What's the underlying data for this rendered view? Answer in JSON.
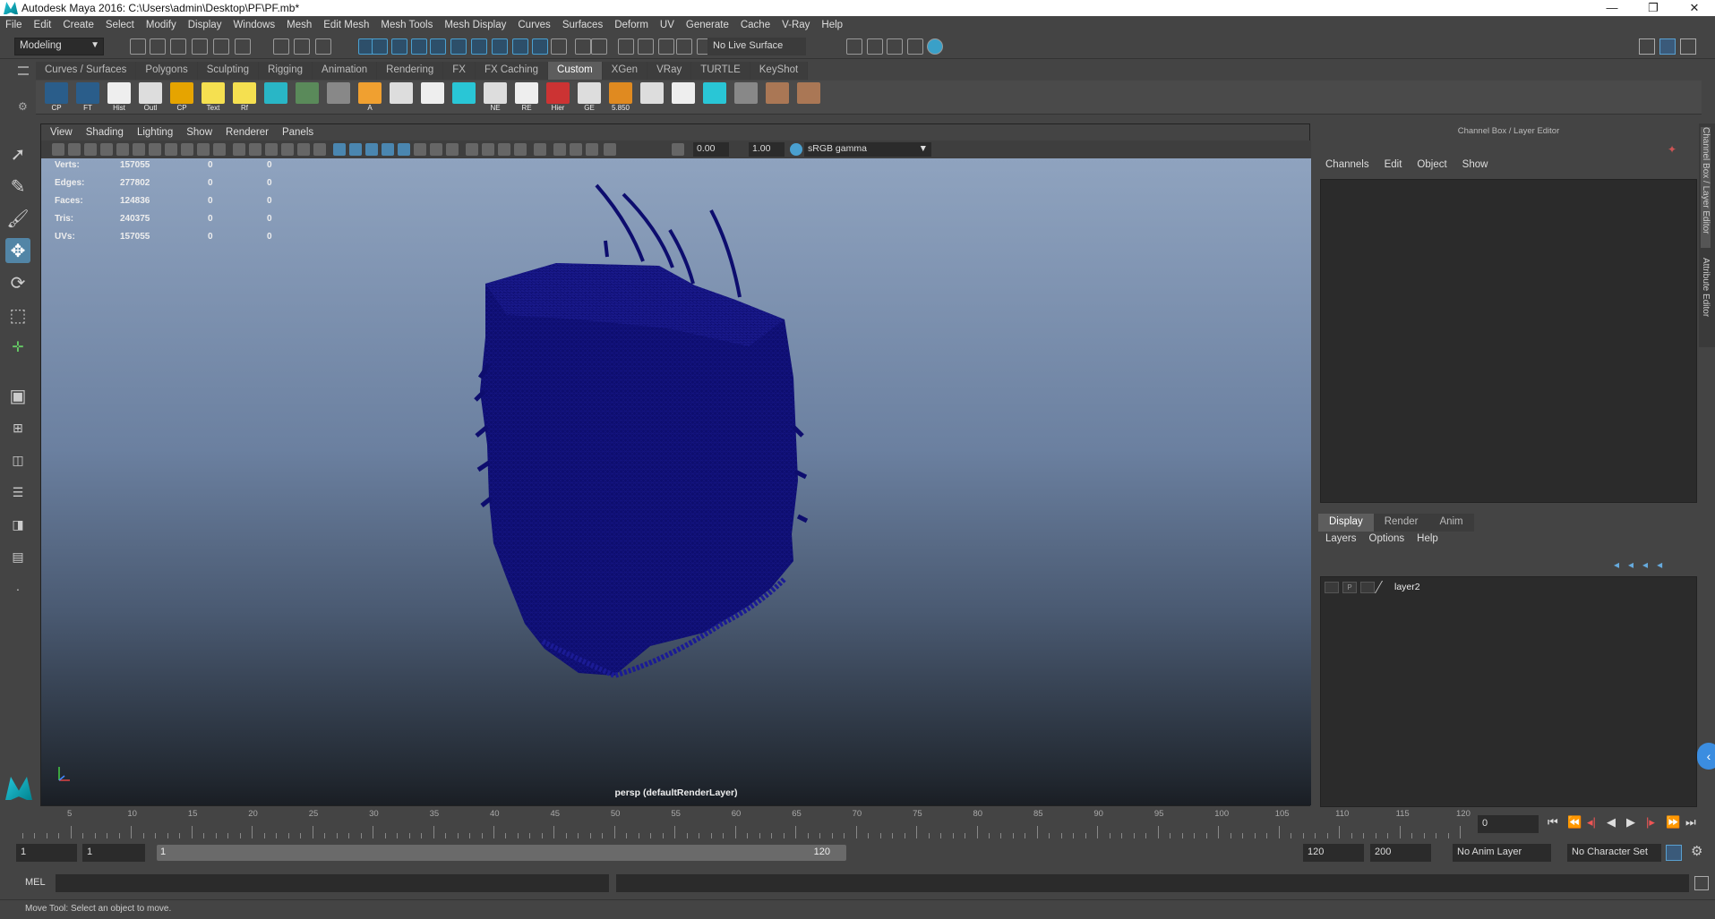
{
  "window": {
    "title": "Autodesk Maya 2016: C:\\Users\\admin\\Desktop\\PF\\PF.mb*",
    "minimize": "—",
    "maximize": "❐",
    "close": "✕"
  },
  "menubar": [
    "File",
    "Edit",
    "Create",
    "Select",
    "Modify",
    "Display",
    "Windows",
    "Mesh",
    "Edit Mesh",
    "Mesh Tools",
    "Mesh Display",
    "Curves",
    "Surfaces",
    "Deform",
    "UV",
    "Generate",
    "Cache",
    "V-Ray",
    "Help"
  ],
  "statusline": {
    "mode": "Modeling",
    "live_surface": "No Live Surface"
  },
  "shelf_tabs": [
    "Curves / Surfaces",
    "Polygons",
    "Sculpting",
    "Rigging",
    "Animation",
    "Rendering",
    "FX",
    "FX Caching",
    "Custom",
    "XGen",
    "VRay",
    "TURTLE",
    "KeyShot"
  ],
  "shelf_active": "Custom",
  "shelf_icons": [
    {
      "label": "CP",
      "color": "#2a5d8a"
    },
    {
      "label": "FT",
      "color": "#2a5d8a"
    },
    {
      "label": "Hist",
      "color": "#eeeeee"
    },
    {
      "label": "Outl",
      "color": "#dddddd"
    },
    {
      "label": "CP",
      "color": "#e6a400"
    },
    {
      "label": "Text",
      "color": "#f5e050"
    },
    {
      "label": "Rf",
      "color": "#f5e050"
    },
    {
      "label": "",
      "color": "#29b6c6"
    },
    {
      "label": "",
      "color": "#5a8a5a"
    },
    {
      "label": "",
      "color": "#888888"
    },
    {
      "label": "A",
      "color": "#f0a030"
    },
    {
      "label": "",
      "color": "#dddddd"
    },
    {
      "label": "",
      "color": "#eeeeee"
    },
    {
      "label": "",
      "color": "#29c6d6"
    },
    {
      "label": "NE",
      "color": "#dddddd"
    },
    {
      "label": "RE",
      "color": "#eeeeee"
    },
    {
      "label": "Hier",
      "color": "#cc3333"
    },
    {
      "label": "GE",
      "color": "#dddddd"
    },
    {
      "label": "5.850",
      "color": "#e08a20"
    },
    {
      "label": "",
      "color": "#dddddd"
    },
    {
      "label": "",
      "color": "#eeeeee"
    },
    {
      "label": "",
      "color": "#29c6d6"
    },
    {
      "label": "",
      "color": "#888888"
    },
    {
      "label": "",
      "color": "#aa7755"
    },
    {
      "label": "",
      "color": "#aa7755"
    }
  ],
  "viewport": {
    "menu": [
      "View",
      "Shading",
      "Lighting",
      "Show",
      "Renderer",
      "Panels"
    ],
    "near_value": "0.00",
    "far_value": "1.00",
    "color_space": "sRGB gamma",
    "camera_label": "persp (defaultRenderLayer)",
    "hud": [
      {
        "name": "Verts:",
        "v1": "157055",
        "v2": "0",
        "v3": "0"
      },
      {
        "name": "Edges:",
        "v1": "277802",
        "v2": "0",
        "v3": "0"
      },
      {
        "name": "Faces:",
        "v1": "124836",
        "v2": "0",
        "v3": "0"
      },
      {
        "name": "Tris:",
        "v1": "240375",
        "v2": "0",
        "v3": "0"
      },
      {
        "name": "UVs:",
        "v1": "157055",
        "v2": "0",
        "v3": "0"
      }
    ],
    "mesh_color": "#0d0d6e"
  },
  "channelbox": {
    "title": "Channel Box / Layer Editor",
    "menu": [
      "Channels",
      "Edit",
      "Object",
      "Show"
    ],
    "layer_tabs": [
      "Display",
      "Render",
      "Anim"
    ],
    "layer_menu": [
      "Layers",
      "Options",
      "Help"
    ],
    "layers": [
      {
        "name": "layer2",
        "p": "P"
      }
    ],
    "side_tab_1": "Channel Box / Layer Editor",
    "side_tab_2": "Attribute Editor"
  },
  "timeline": {
    "ticks": [
      5,
      10,
      15,
      20,
      25,
      30,
      35,
      40,
      45,
      50,
      55,
      60,
      65,
      70,
      75,
      80,
      85,
      90,
      95,
      100,
      105,
      110,
      115,
      120
    ],
    "current_frame": "0"
  },
  "range": {
    "start": "1",
    "start_inner": "1",
    "slider_start": "1",
    "slider_end": "120",
    "end_inner": "120",
    "end": "200",
    "anim_layer": "No Anim Layer",
    "char_set": "No Character Set"
  },
  "mel": {
    "label": "MEL"
  },
  "status": "Move Tool: Select an object to move."
}
